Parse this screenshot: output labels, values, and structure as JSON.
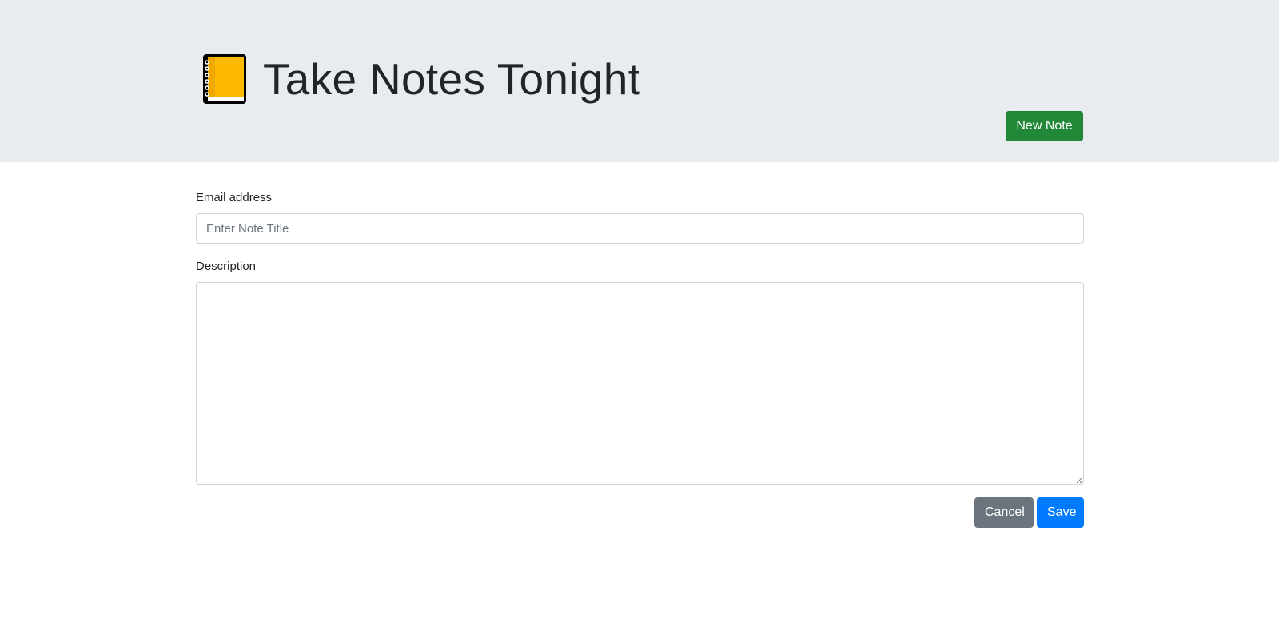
{
  "header": {
    "title": "Take Notes Tonight",
    "logo_icon": "notebook-icon",
    "new_note_label": "New Note"
  },
  "form": {
    "title_label": "Email address",
    "title_placeholder": "Enter Note Title",
    "title_value": "",
    "description_label": "Description",
    "description_value": "",
    "cancel_label": "Cancel",
    "save_label": "Save"
  },
  "colors": {
    "header_bg": "#e9ecef",
    "new_note_button": "#218838",
    "cancel_button": "#6c757d",
    "save_button": "#007bff",
    "notebook_cover": "#ffb900"
  }
}
